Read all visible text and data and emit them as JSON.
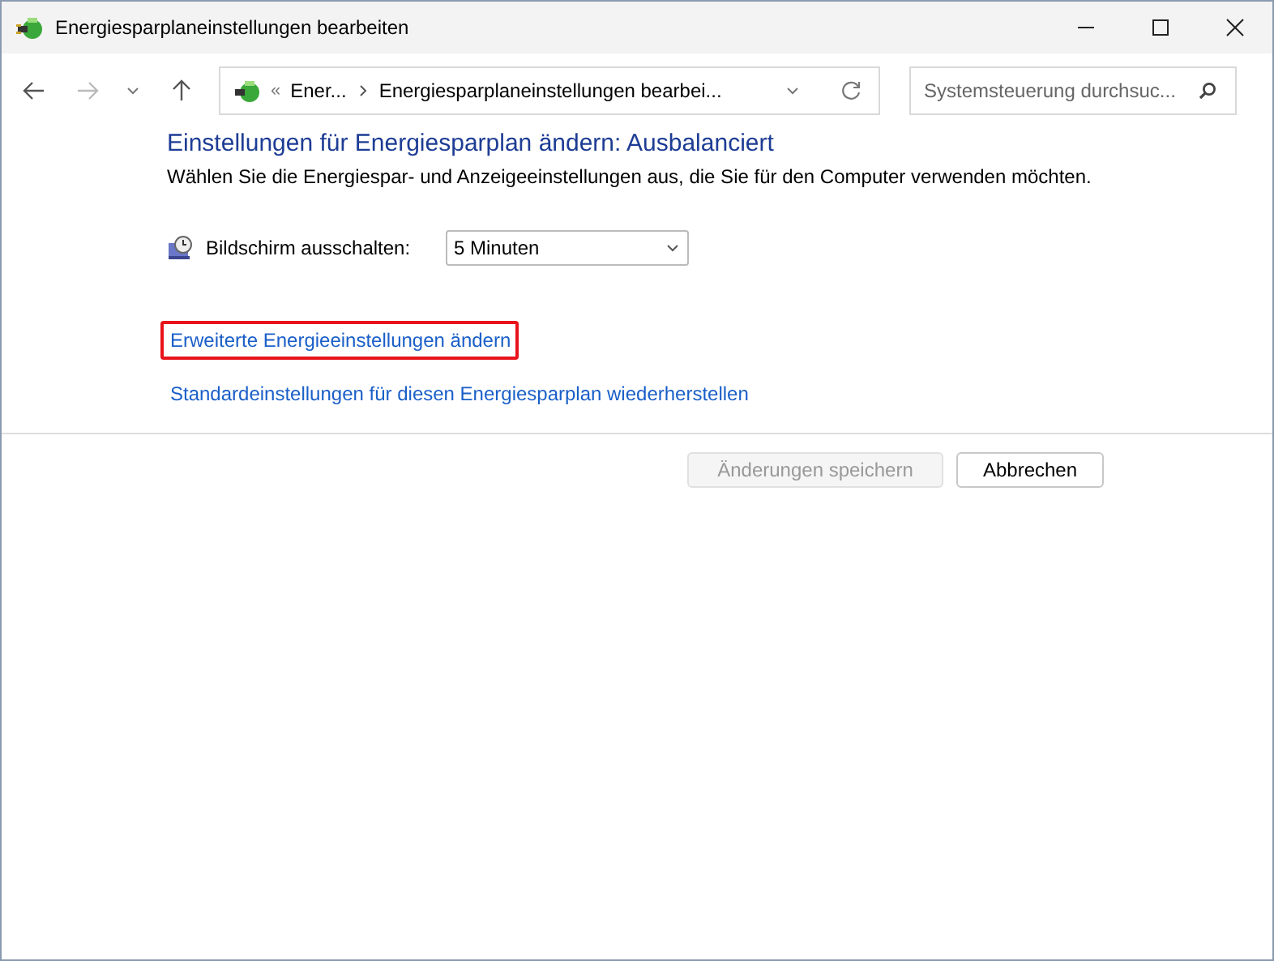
{
  "window": {
    "title": "Energiesparplaneinstellungen bearbeiten"
  },
  "nav": {
    "back_disabled": false,
    "forward_disabled": true
  },
  "address": {
    "overflow": "«",
    "crumbs": [
      "Ener...",
      "Energiesparplaneinstellungen bearbei..."
    ]
  },
  "search": {
    "placeholder": "Systemsteuerung durchsuc..."
  },
  "heading": "Einstellungen für Energiesparplan ändern: Ausbalanciert",
  "description": "Wählen Sie die Energiespar- und Anzeigeeinstellungen aus, die Sie für den Computer verwenden möchten.",
  "settings": [
    {
      "label": "Bildschirm ausschalten:",
      "value": "5 Minuten"
    }
  ],
  "links": [
    {
      "text": "Erweiterte Energieeinstellungen ändern",
      "highlighted": true
    },
    {
      "text": "Standardeinstellungen für diesen Energiesparplan wiederherstellen",
      "highlighted": false
    }
  ],
  "buttons": [
    {
      "label": "Änderungen speichern",
      "disabled": true
    },
    {
      "label": "Abbrechen",
      "disabled": false
    }
  ]
}
